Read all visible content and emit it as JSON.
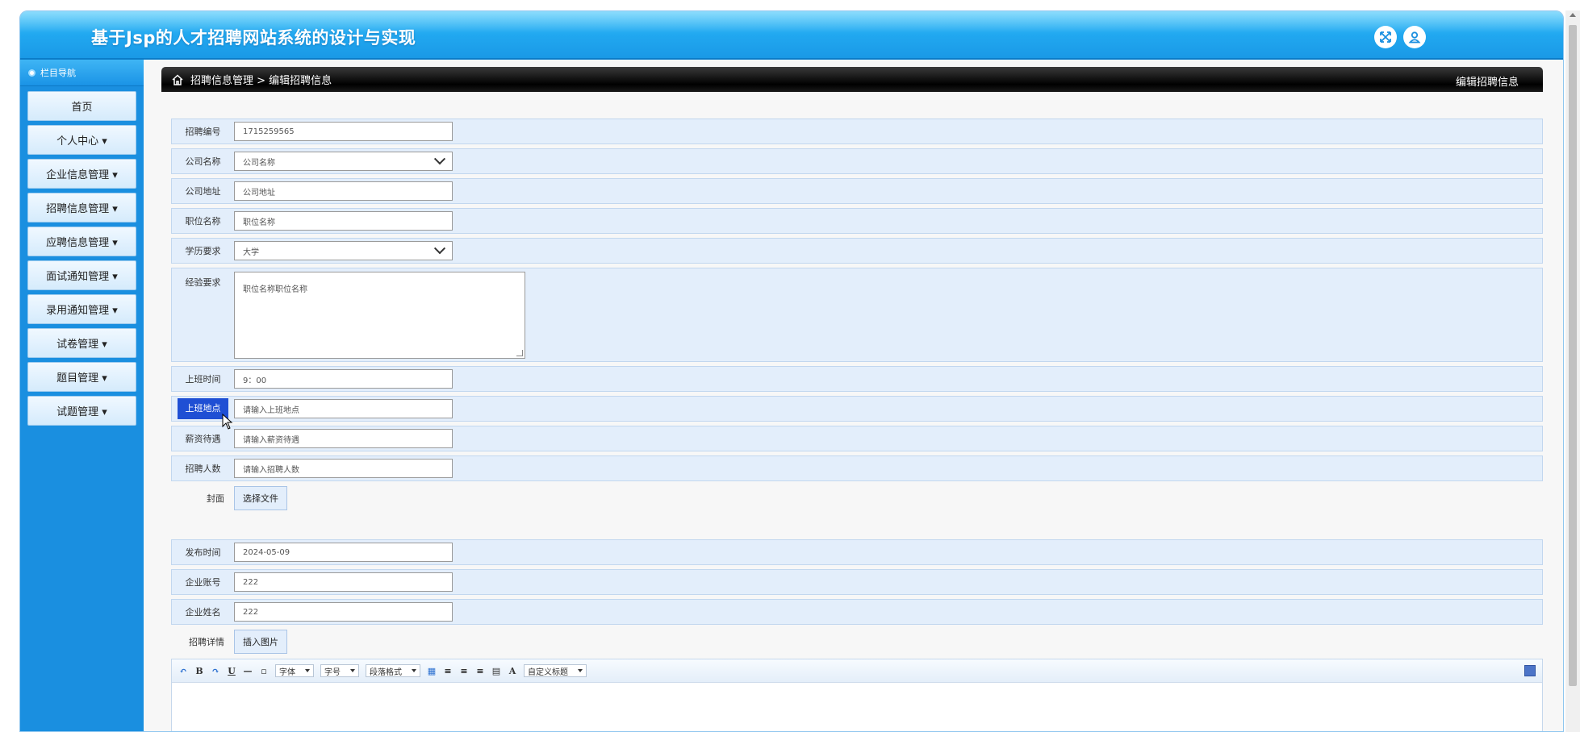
{
  "app": {
    "title": "基于Jsp的人才招聘网站系统的设计与实现",
    "header_icons": [
      "fullscreen-icon",
      "user-icon"
    ]
  },
  "sidebar": {
    "heading": "栏目导航",
    "items": [
      {
        "label": "首页"
      },
      {
        "label": "个人中心 ▾"
      },
      {
        "label": "企业信息管理 ▾"
      },
      {
        "label": "招聘信息管理 ▾"
      },
      {
        "label": "应聘信息管理 ▾"
      },
      {
        "label": "面试通知管理 ▾"
      },
      {
        "label": "录用通知管理 ▾"
      },
      {
        "label": "试卷管理 ▾"
      },
      {
        "label": "题目管理 ▾"
      },
      {
        "label": "试题管理 ▾"
      }
    ]
  },
  "breadcrumb": {
    "path": "招聘信息管理 > 编辑招聘信息",
    "right_title": "编辑招聘信息"
  },
  "form": {
    "recruit_no": {
      "label": "招聘编号",
      "value": "1715259565"
    },
    "company_name": {
      "label": "公司名称",
      "selected": "公司名称"
    },
    "company_address": {
      "label": "公司地址",
      "value": "公司地址"
    },
    "position_name": {
      "label": "职位名称",
      "value": "职位名称"
    },
    "education": {
      "label": "学历要求",
      "selected": "大学"
    },
    "experience": {
      "label": "经验要求",
      "value": "职位名称职位名称"
    },
    "work_time": {
      "label": "上班时间",
      "value": "9：00"
    },
    "work_place": {
      "label": "上班地点",
      "placeholder": "请输入上班地点"
    },
    "salary": {
      "label": "薪资待遇",
      "placeholder": "请输入薪资待遇"
    },
    "headcount": {
      "label": "招聘人数",
      "placeholder": "请输入招聘人数"
    },
    "cover": {
      "label": "封面",
      "button": "选择文件"
    },
    "publish_date": {
      "label": "发布时间",
      "value": "2024-05-09"
    },
    "company_account": {
      "label": "企业账号",
      "value": "222"
    },
    "company_person": {
      "label": "企业姓名",
      "value": "222"
    },
    "details": {
      "label": "招聘详情",
      "button": "插入图片"
    }
  },
  "editor_toolbar": {
    "bold": "B",
    "underline": "U",
    "font": "字体",
    "size": "字号",
    "paragraph": "段落格式",
    "color": "A",
    "custom_title": "自定义标题"
  }
}
